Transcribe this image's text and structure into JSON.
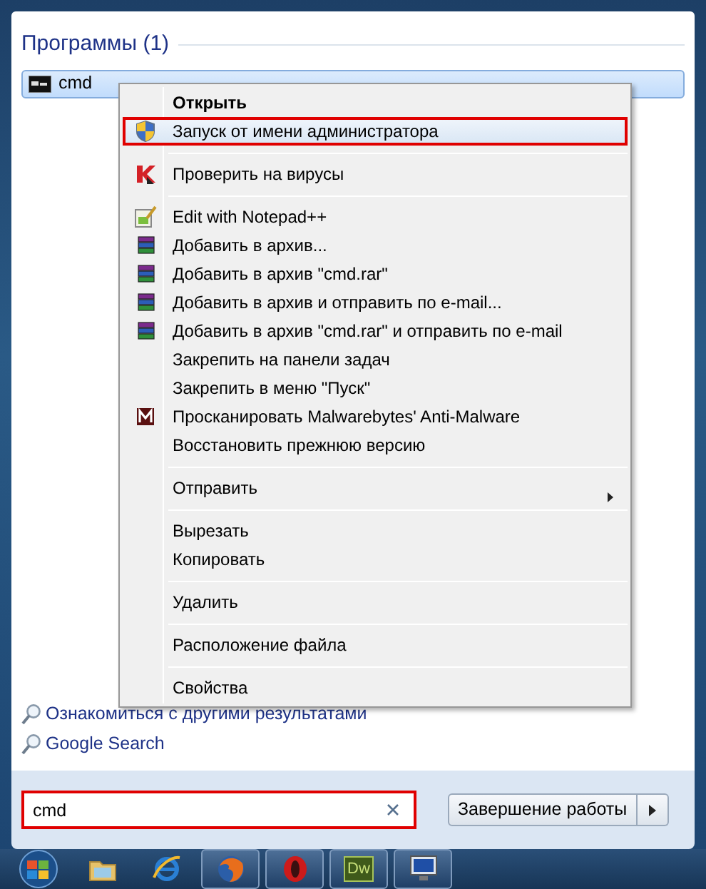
{
  "section_title": "Программы (1)",
  "results": [
    {
      "label": "cmd",
      "selected": true
    }
  ],
  "context_menu": [
    {
      "kind": "plain",
      "label": "Открыть",
      "bold": true,
      "highlighted": false
    },
    {
      "kind": "shield",
      "label": "Запуск от имени администратора",
      "bold": false,
      "highlighted": true
    },
    {
      "kind": "separator"
    },
    {
      "kind": "antivirus",
      "label": "Проверить на вирусы",
      "bold": false,
      "highlighted": false
    },
    {
      "kind": "separator"
    },
    {
      "kind": "notepad",
      "label": "Edit with Notepad++",
      "bold": false,
      "highlighted": false
    },
    {
      "kind": "archive",
      "label": "Добавить в архив...",
      "bold": false,
      "highlighted": false
    },
    {
      "kind": "archive",
      "label": "Добавить в архив \"cmd.rar\"",
      "bold": false,
      "highlighted": false
    },
    {
      "kind": "archive",
      "label": "Добавить в архив и отправить по e-mail...",
      "bold": false,
      "highlighted": false
    },
    {
      "kind": "archive",
      "label": "Добавить в архив \"cmd.rar\" и отправить по e-mail",
      "bold": false,
      "highlighted": false
    },
    {
      "kind": "plain",
      "label": "Закрепить на панели задач",
      "bold": false,
      "highlighted": false
    },
    {
      "kind": "plain",
      "label": "Закрепить в меню \"Пуск\"",
      "bold": false,
      "highlighted": false
    },
    {
      "kind": "malware",
      "label": "Просканировать Malwarebytes' Anti-Malware",
      "bold": false,
      "highlighted": false
    },
    {
      "kind": "plain",
      "label": "Восстановить прежнюю версию",
      "bold": false,
      "highlighted": false
    },
    {
      "kind": "separator"
    },
    {
      "kind": "submenu",
      "label": "Отправить",
      "bold": false,
      "highlighted": false
    },
    {
      "kind": "separator"
    },
    {
      "kind": "plain",
      "label": "Вырезать",
      "bold": false,
      "highlighted": false
    },
    {
      "kind": "plain",
      "label": "Копировать",
      "bold": false,
      "highlighted": false
    },
    {
      "kind": "separator"
    },
    {
      "kind": "plain",
      "label": "Удалить",
      "bold": false,
      "highlighted": false
    },
    {
      "kind": "separator"
    },
    {
      "kind": "plain",
      "label": "Расположение файла",
      "bold": false,
      "highlighted": false
    },
    {
      "kind": "separator"
    },
    {
      "kind": "plain",
      "label": "Свойства",
      "bold": false,
      "highlighted": false
    }
  ],
  "links": [
    {
      "label": "Ознакомиться с другими результатами"
    },
    {
      "label": "Google Search"
    }
  ],
  "search": {
    "value": "cmd",
    "highlighted": true
  },
  "shutdown": {
    "label": "Завершение работы"
  },
  "taskbar": [
    {
      "kind": "start",
      "running": false
    },
    {
      "kind": "folder",
      "running": false
    },
    {
      "kind": "ie",
      "running": false
    },
    {
      "kind": "firefox",
      "running": true
    },
    {
      "kind": "opera",
      "running": true
    },
    {
      "kind": "dw",
      "label": "Dw",
      "running": true
    },
    {
      "kind": "monitor",
      "running": true
    }
  ]
}
